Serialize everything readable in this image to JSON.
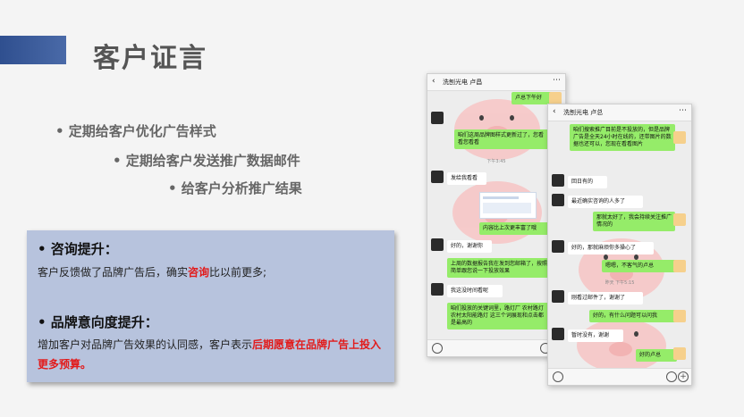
{
  "slide": {
    "title": "客户证言",
    "bullets": [
      "• 定期给客户优化广告样式",
      "• 定期给客户发送推广数据邮件",
      "• 给客户分析推广结果"
    ]
  },
  "info_box": {
    "h1": "• 咨询提升：",
    "p1_a": "客户反馈做了品牌广告后，确实",
    "p1_red": "咨询",
    "p1_b": "比以前更多;",
    "h2": "• 品牌意向度提升：",
    "p2_a": "增加客户对品牌广告效果的认同感，客户表示",
    "p2_red": "后期愿意在品牌广告上投入更多预算。"
  },
  "colors": {
    "accent": "#2f4f8f",
    "box_bg": "#b7c3dd",
    "highlight": "#e21b1b",
    "wechat_green": "#95ec69"
  },
  "phone1": {
    "header": "洗刨光电 卢昌",
    "messages": [
      "卢总下午好",
      "咱们这周品牌图样式更新过了，您看看您看看",
      "下午3:45",
      "发给我看看",
      "内容比上次更丰富了哦",
      "好的，谢谢你",
      "上周的数据报告我在发到您邮箱了，按照简单跟您说一下投放效果",
      "我这没时间看呢",
      "咱们投放的关键词里，路灯厂 农村路灯 农村太阳能路灯 这三个词展现和点击都是最高的"
    ]
  },
  "phone2": {
    "header": "洗刨光电 卢总",
    "messages": [
      "咱们搜索推广目前是不投放的，但是品牌广告是全天24小时在线的，还带图片的数据也还可以，您现在看看图片",
      "回日有的",
      "最近确实咨询的人多了",
      "那就太好了，我会持续关注推广情况的",
      "好的，那就麻烦你多操心了",
      "嗯嗯，不客气的卢总",
      "昨天 下午5:15",
      "刚看过邮件了，谢谢了",
      "好的，有什么问题可以问我",
      "暂时没有，谢谢",
      "好的卢总"
    ]
  },
  "icons": [
    "back-arrow-icon",
    "more-icon",
    "voice-icon",
    "emoji-icon",
    "plus-icon"
  ]
}
